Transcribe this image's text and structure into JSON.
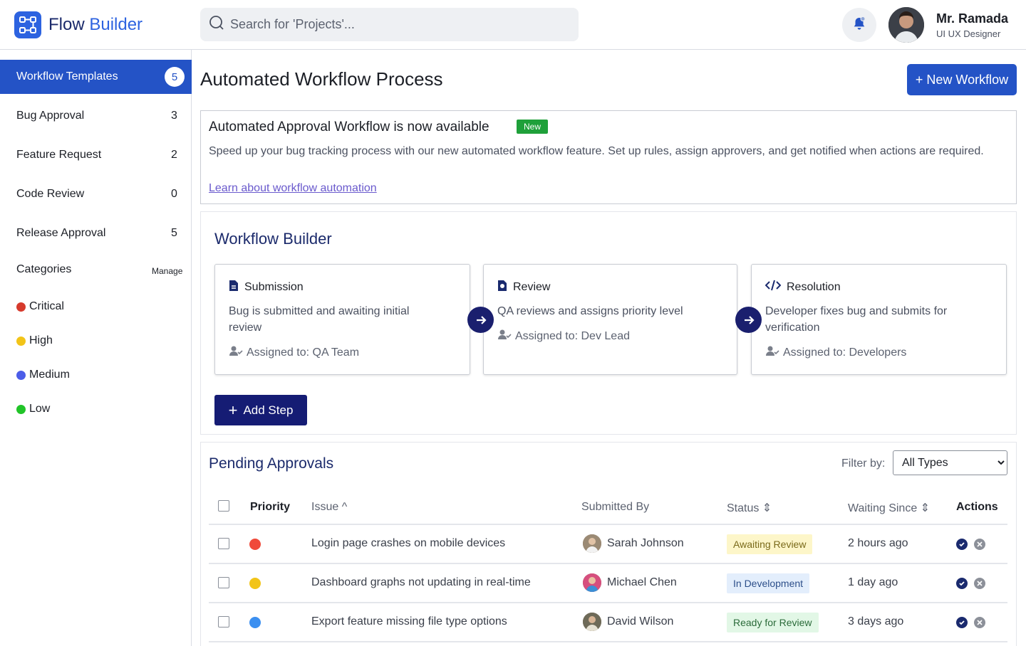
{
  "app": {
    "title_part1": "Flow ",
    "title_part2": "Builder",
    "logo_icon": "workflow-logo-icon",
    "brand_color": "#2453c6"
  },
  "search": {
    "placeholder": "Search for 'Projects'..."
  },
  "user": {
    "name": "Mr. Ramada",
    "role": "UI UX Designer"
  },
  "sidebar": {
    "active": {
      "label": "Workflow Templates",
      "count": "5"
    },
    "items": [
      {
        "label": "Bug Approval",
        "count": "3"
      },
      {
        "label": "Feature Request",
        "count": "2"
      },
      {
        "label": "Code Review",
        "count": "0"
      },
      {
        "label": "Release Approval",
        "count": "5"
      }
    ],
    "categories_label": "Categories",
    "manage_label": "Manage",
    "categories": [
      {
        "label": "Critical",
        "color": "#d63a2c"
      },
      {
        "label": "High",
        "color": "#f2c418"
      },
      {
        "label": "Medium",
        "color": "#4c5de8"
      },
      {
        "label": "Low",
        "color": "#21c428"
      }
    ]
  },
  "main": {
    "title": "Automated Workflow Process",
    "new_workflow_label": "+ New Workflow"
  },
  "banner": {
    "title": "Automated Approval Workflow is now available",
    "badge": "New",
    "description": "Speed up your bug tracking process with our new automated workflow feature. Set up rules, assign approvers, and get notified when actions are required.",
    "link": "Learn about workflow automation"
  },
  "workflow_builder": {
    "title": "Workflow Builder",
    "steps": [
      {
        "title": "Submission",
        "icon": "file-icon",
        "description": "Bug is submitted and awaiting initial review",
        "assigned": "Assigned to: QA Team"
      },
      {
        "title": "Review",
        "icon": "review-icon",
        "description": "QA reviews and assigns priority level",
        "assigned": "Assigned to: Dev Lead"
      },
      {
        "title": "Resolution",
        "icon": "code-icon",
        "description": "Developer fixes bug and submits for verification",
        "assigned": "Assigned to: Developers"
      }
    ],
    "add_step_label": "Add Step"
  },
  "pending": {
    "title": "Pending Approvals",
    "filter_label": "Filter by:",
    "filter_value": "All Types",
    "columns": {
      "priority": "Priority",
      "issue": "Issue ^",
      "submitted_by": "Submitted By",
      "status": "Status ⇕",
      "waiting_since": "Waiting Since ⇕",
      "actions": "Actions"
    },
    "rows": [
      {
        "priority_color": "#f04a3a",
        "issue": "Login page crashes on mobile devices",
        "submitted_by": "Sarah Johnson",
        "status": "Awaiting Review",
        "status_bg": "#fdf6c9",
        "status_fg": "#7a6a1a",
        "waiting": "2 hours ago"
      },
      {
        "priority_color": "#f2c418",
        "issue": "Dashboard graphs not updating in real-time",
        "submitted_by": "Michael Chen",
        "status": "In Development",
        "status_bg": "#e3eefc",
        "status_fg": "#2d4f8a",
        "waiting": "1 day ago"
      },
      {
        "priority_color": "#3b8ff0",
        "issue": "Export feature missing file type options",
        "submitted_by": "David Wilson",
        "status": "Ready for Review",
        "status_bg": "#e2f7e6",
        "status_fg": "#2b6b3a",
        "waiting": "3 days ago"
      }
    ]
  }
}
